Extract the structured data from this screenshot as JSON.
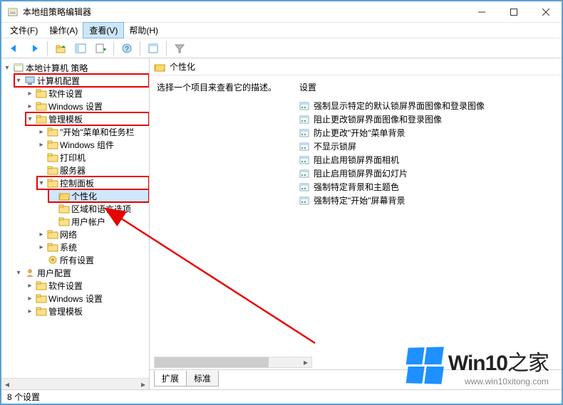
{
  "window": {
    "title": "本地组策略编辑器"
  },
  "menus": {
    "file": "文件(F)",
    "action": "操作(A)",
    "view": "查看(V)",
    "help": "帮助(H)"
  },
  "tree": {
    "root": "本地计算机 策略",
    "computer_config": "计算机配置",
    "software_settings": "软件设置",
    "windows_settings": "Windows 设置",
    "admin_templates": "管理模板",
    "start_menu": "\"开始\"菜单和任务栏",
    "windows_components": "Windows 组件",
    "printers": "打印机",
    "server": "服务器",
    "control_panel": "控制面板",
    "personalization": "个性化",
    "region_language": "区域和语言选项",
    "user_accounts": "用户帐户",
    "network": "网络",
    "system": "系统",
    "all_settings": "所有设置",
    "user_config": "用户配置",
    "u_software_settings": "软件设置",
    "u_windows_settings": "Windows 设置",
    "u_admin_templates": "管理模板"
  },
  "content": {
    "header_title": "个性化",
    "description": "选择一个项目来查看它的描述。",
    "settings_header": "设置",
    "items": [
      "强制显示特定的默认锁屏界面图像和登录图像",
      "阻止更改锁屏界面图像和登录图像",
      "防止更改\"开始\"菜单背景",
      "不显示锁屏",
      "阻止启用锁屏界面相机",
      "阻止启用锁屏界面幻灯片",
      "强制特定背景和主题色",
      "强制特定\"开始\"屏幕背景"
    ]
  },
  "tabs": {
    "extended": "扩展",
    "standard": "标准"
  },
  "status": "8 个设置",
  "watermark": {
    "brand": "Win10",
    "suffix": "之家",
    "url": "www.win10xitong.com"
  }
}
